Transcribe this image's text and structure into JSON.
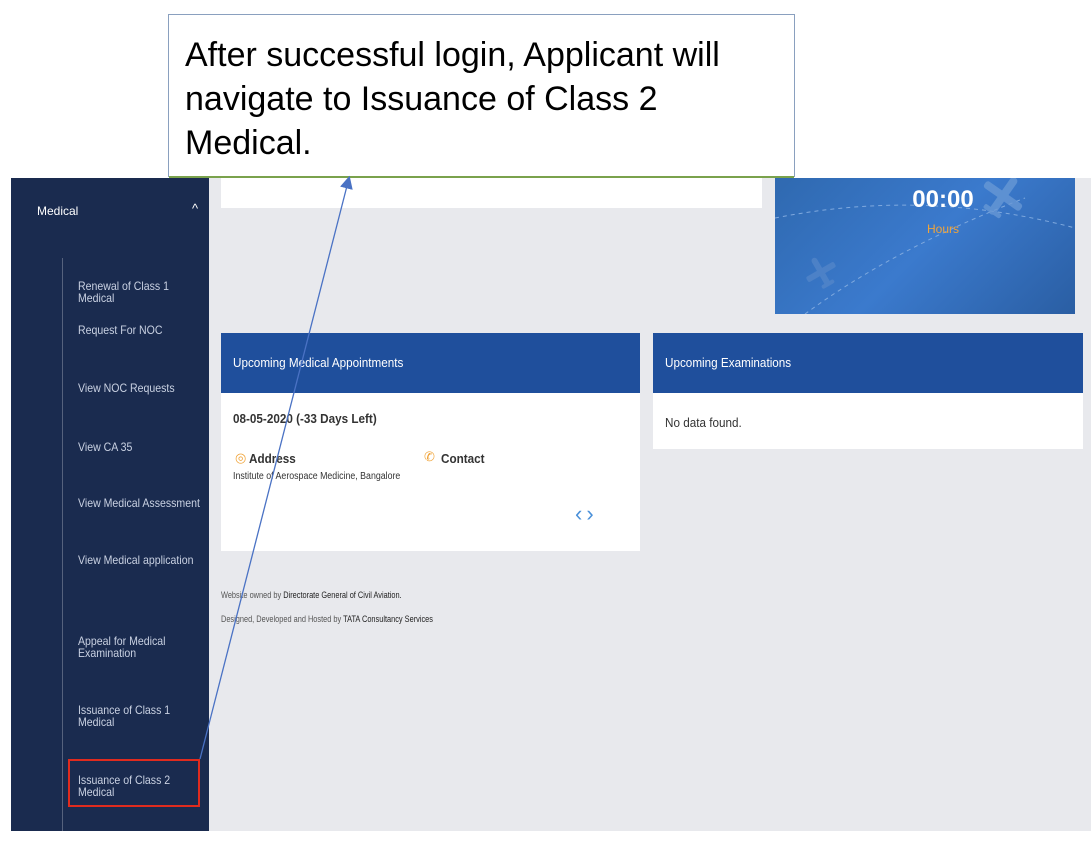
{
  "annotation": {
    "text": "After successful login, Applicant will navigate to Issuance of Class 2 Medical."
  },
  "sidebar": {
    "section_label": "Medical",
    "items": [
      {
        "label": "Renewal of Class 1 Medical"
      },
      {
        "label": "Request For NOC"
      },
      {
        "label": "View NOC Requests"
      },
      {
        "label": "View CA 35"
      },
      {
        "label": "View Medical Assessment"
      },
      {
        "label": "View Medical application"
      },
      {
        "label": "Appeal for Medical Examination"
      },
      {
        "label": "Issuance of Class 1 Medical"
      },
      {
        "label": "Issuance of Class 2 Medical"
      }
    ]
  },
  "timer": {
    "value": "00:00",
    "unit": "Hours"
  },
  "appointments": {
    "title": "Upcoming Medical Appointments",
    "date": "08-05-2020 (-33 Days Left)",
    "address_label": "Address",
    "address_text": "Institute of Aerospace Medicine, Bangalore",
    "contact_label": "Contact"
  },
  "examinations": {
    "title": "Upcoming Examinations",
    "empty_text": "No data found."
  },
  "footer": {
    "owned_prefix": "Website owned by",
    "owned_by": "Directorate General of Civil Aviation.",
    "hosted_prefix": "Designed, Developed and Hosted by",
    "hosted_by": "TATA Consultancy Services"
  },
  "colors": {
    "sidebar_bg": "#1a2b4f",
    "card_header": "#1f4f9c",
    "accent_orange": "#f0a43a",
    "highlight_red": "#e02b1e"
  },
  "icons": {
    "section_chevron": "chevron-up-icon",
    "address": "location-pin-icon",
    "contact": "phone-icon",
    "prev": "chevron-left-icon",
    "next": "chevron-right-icon"
  }
}
